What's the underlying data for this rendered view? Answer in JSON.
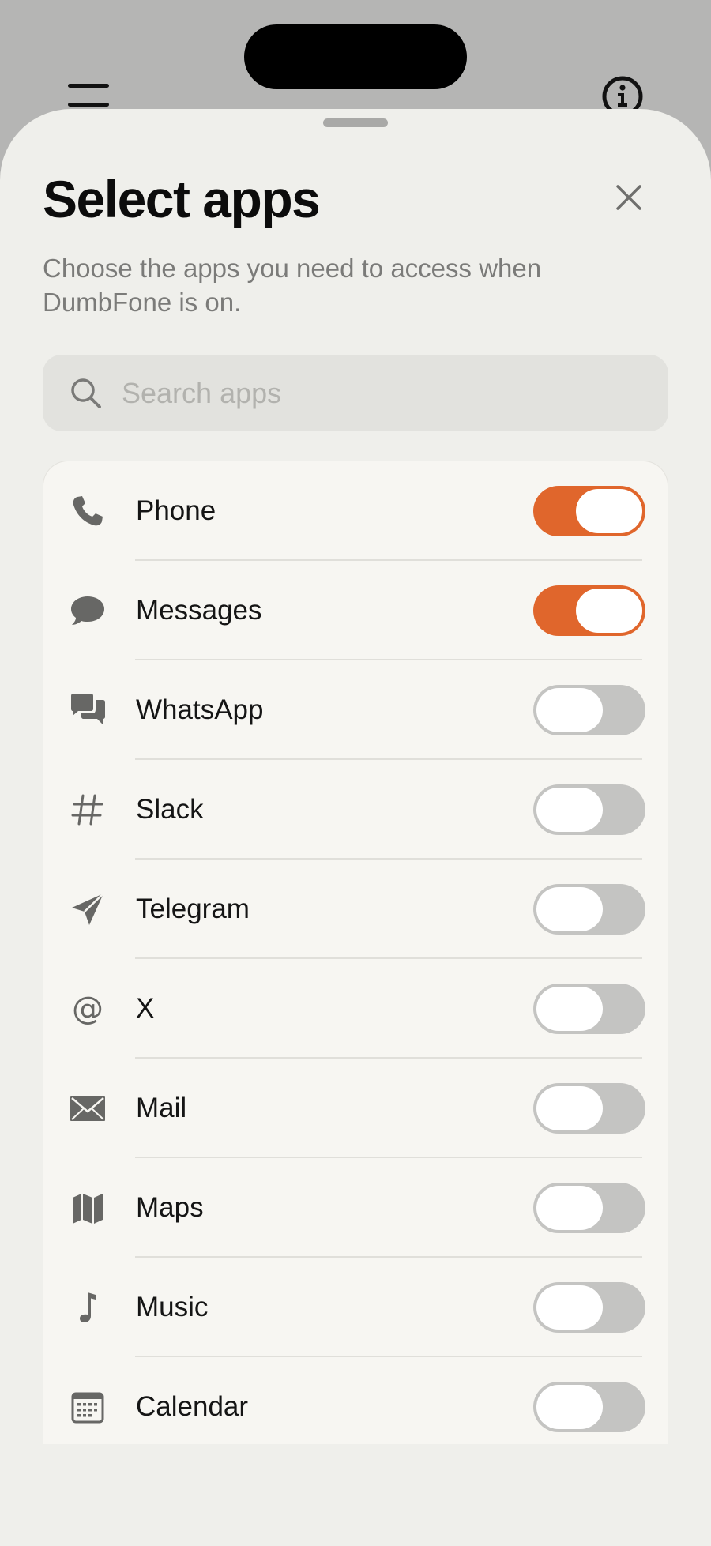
{
  "sheet": {
    "title": "Select apps",
    "subtitle": "Choose the apps you need to access when DumbFone is on."
  },
  "search": {
    "placeholder": "Search apps",
    "value": ""
  },
  "apps": [
    {
      "label": "Phone",
      "icon": "phone-icon",
      "enabled": true
    },
    {
      "label": "Messages",
      "icon": "message-bubble-icon",
      "enabled": true
    },
    {
      "label": "WhatsApp",
      "icon": "chat-bubbles-icon",
      "enabled": false
    },
    {
      "label": "Slack",
      "icon": "hashtag-icon",
      "enabled": false
    },
    {
      "label": "Telegram",
      "icon": "paper-plane-icon",
      "enabled": false
    },
    {
      "label": "X",
      "icon": "at-sign-icon",
      "enabled": false
    },
    {
      "label": "Mail",
      "icon": "envelope-icon",
      "enabled": false
    },
    {
      "label": "Maps",
      "icon": "map-icon",
      "enabled": false
    },
    {
      "label": "Music",
      "icon": "music-note-icon",
      "enabled": false
    },
    {
      "label": "Calendar",
      "icon": "calendar-icon",
      "enabled": false
    }
  ],
  "colors": {
    "accent": "#e0662c",
    "toggle_off": "#c4c4c2",
    "sheet_background": "#efefeb",
    "list_background": "#f7f6f2"
  }
}
